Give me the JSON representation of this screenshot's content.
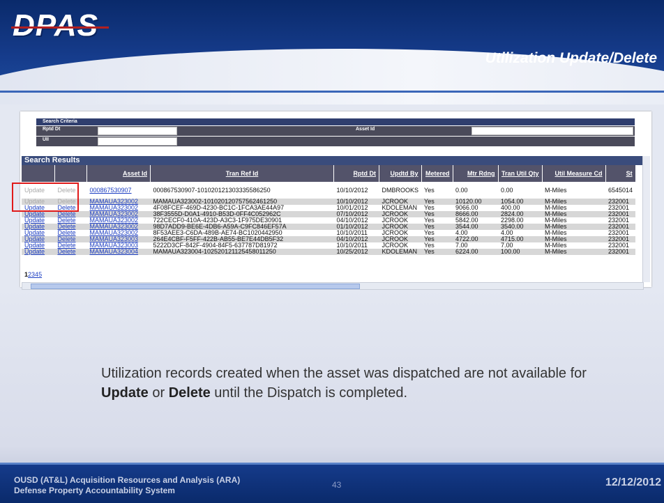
{
  "logo": "DPAS",
  "slide_title": "Utilization Update/Delete",
  "search_criteria": {
    "heading": "Search Criteria",
    "fields": [
      {
        "label": "Rptd Dt",
        "value": ""
      },
      {
        "label": "Asset Id",
        "value": ""
      },
      {
        "label": "UII",
        "value": ""
      }
    ]
  },
  "search_results": {
    "heading": "Search Results",
    "columns": [
      "",
      "",
      "Asset Id",
      "Tran Ref Id",
      "Rptd Dt",
      "Updtd By",
      "Metered",
      "Mtr Rdng",
      "Tran Util Qty",
      "Util Measure Cd",
      "St"
    ],
    "rows": [
      {
        "update": "Update",
        "delete": "Delete",
        "asset_id": "000867530907",
        "tran_ref_id": "000867530907-101020121303335586250",
        "rptd_dt": "10/10/2012",
        "updtd_by": "DMBROOKS",
        "metered": "Yes",
        "mtr_rdng": "0.00",
        "tran_util_qty": "0.00",
        "util_measure_cd": "M-Miles",
        "st": "6545014"
      },
      {
        "update": "Update",
        "delete": "Delete",
        "asset_id": "MAMAUA323002",
        "tran_ref_id": "MAMAUA323002-101020120757562461250",
        "rptd_dt": "10/10/2012",
        "updtd_by": "JCROOK",
        "metered": "Yes",
        "mtr_rdng": "10120.00",
        "tran_util_qty": "1054.00",
        "util_measure_cd": "M-Miles",
        "st": "232001"
      },
      {
        "update": "Update",
        "delete": "Delete",
        "asset_id": "MAMAUA323002",
        "tran_ref_id": "4F08FCEF-469D-4230-BC1C-1FCA3AE44A97",
        "rptd_dt": "10/01/2012",
        "updtd_by": "KDOLEMAN",
        "metered": "Yes",
        "mtr_rdng": "9066.00",
        "tran_util_qty": "400.00",
        "util_measure_cd": "M-Miles",
        "st": "232001"
      },
      {
        "update": "Update",
        "delete": "Delete",
        "asset_id": "MAMAUA323002",
        "tran_ref_id": "38F3555D-D0A1-4910-B53D-0FF4C052962C",
        "rptd_dt": "07/10/2012",
        "updtd_by": "JCROOK",
        "metered": "Yes",
        "mtr_rdng": "8666.00",
        "tran_util_qty": "2824.00",
        "util_measure_cd": "M-Miles",
        "st": "232001"
      },
      {
        "update": "Update",
        "delete": "Delete",
        "asset_id": "MAMAUA323002",
        "tran_ref_id": "722CECF0-410A-423D-A3C3-1F975DE30901",
        "rptd_dt": "04/10/2012",
        "updtd_by": "JCROOK",
        "metered": "Yes",
        "mtr_rdng": "5842.00",
        "tran_util_qty": "2298.00",
        "util_measure_cd": "M-Miles",
        "st": "232001"
      },
      {
        "update": "Update",
        "delete": "Delete",
        "asset_id": "MAMAUA323002",
        "tran_ref_id": "98D7ADD9-BE6E-4DB6-A59A-C9FC846EF57A",
        "rptd_dt": "01/10/2012",
        "updtd_by": "JCROOK",
        "metered": "Yes",
        "mtr_rdng": "3544.00",
        "tran_util_qty": "3540.00",
        "util_measure_cd": "M-Miles",
        "st": "232001"
      },
      {
        "update": "Update",
        "delete": "Delete",
        "asset_id": "MAMAUA323002",
        "tran_ref_id": "8F53AEE3-C6DA-489B-AE74-BC1020442950",
        "rptd_dt": "10/10/2011",
        "updtd_by": "JCROOK",
        "metered": "Yes",
        "mtr_rdng": "4.00",
        "tran_util_qty": "4.00",
        "util_measure_cd": "M-Miles",
        "st": "232001"
      },
      {
        "update": "Update",
        "delete": "Delete",
        "asset_id": "MAMAUA323003",
        "tran_ref_id": "264E4CBF-F5FF-422B-AB55-BE7E44DB5F32",
        "rptd_dt": "04/10/2012",
        "updtd_by": "JCROOK",
        "metered": "Yes",
        "mtr_rdng": "4722.00",
        "tran_util_qty": "4715.00",
        "util_measure_cd": "M-Miles",
        "st": "232001"
      },
      {
        "update": "Update",
        "delete": "Delete",
        "asset_id": "MAMAUA323003",
        "tran_ref_id": "5222D3CF-842F-4904-84F5-637787D81972",
        "rptd_dt": "10/10/2011",
        "updtd_by": "JCROOK",
        "metered": "Yes",
        "mtr_rdng": "7.00",
        "tran_util_qty": "7.00",
        "util_measure_cd": "M-Miles",
        "st": "232001"
      },
      {
        "update": "Update",
        "delete": "Delete",
        "asset_id": "MAMAUA323004",
        "tran_ref_id": "MAMAUA323004-102520121125458011250",
        "rptd_dt": "10/25/2012",
        "updtd_by": "KDOLEMAN",
        "metered": "Yes",
        "mtr_rdng": "6224.00",
        "tran_util_qty": "100.00",
        "util_measure_cd": "M-Miles",
        "st": "232001"
      }
    ],
    "pager": {
      "current": "1",
      "pages": [
        "2",
        "3",
        "4",
        "5"
      ]
    }
  },
  "note": {
    "part1": "Utilization records created when the asset was dispatched are not available for ",
    "bold1": "Update",
    "part2": " or ",
    "bold2": "Delete",
    "part3": " until the Dispatch is completed."
  },
  "footer": {
    "line1": "OUSD (AT&L) Acquisition Resources and Analysis (ARA)",
    "line2": "Defense Property Accountability System",
    "page_number": "43",
    "date": "12/12/2012"
  }
}
